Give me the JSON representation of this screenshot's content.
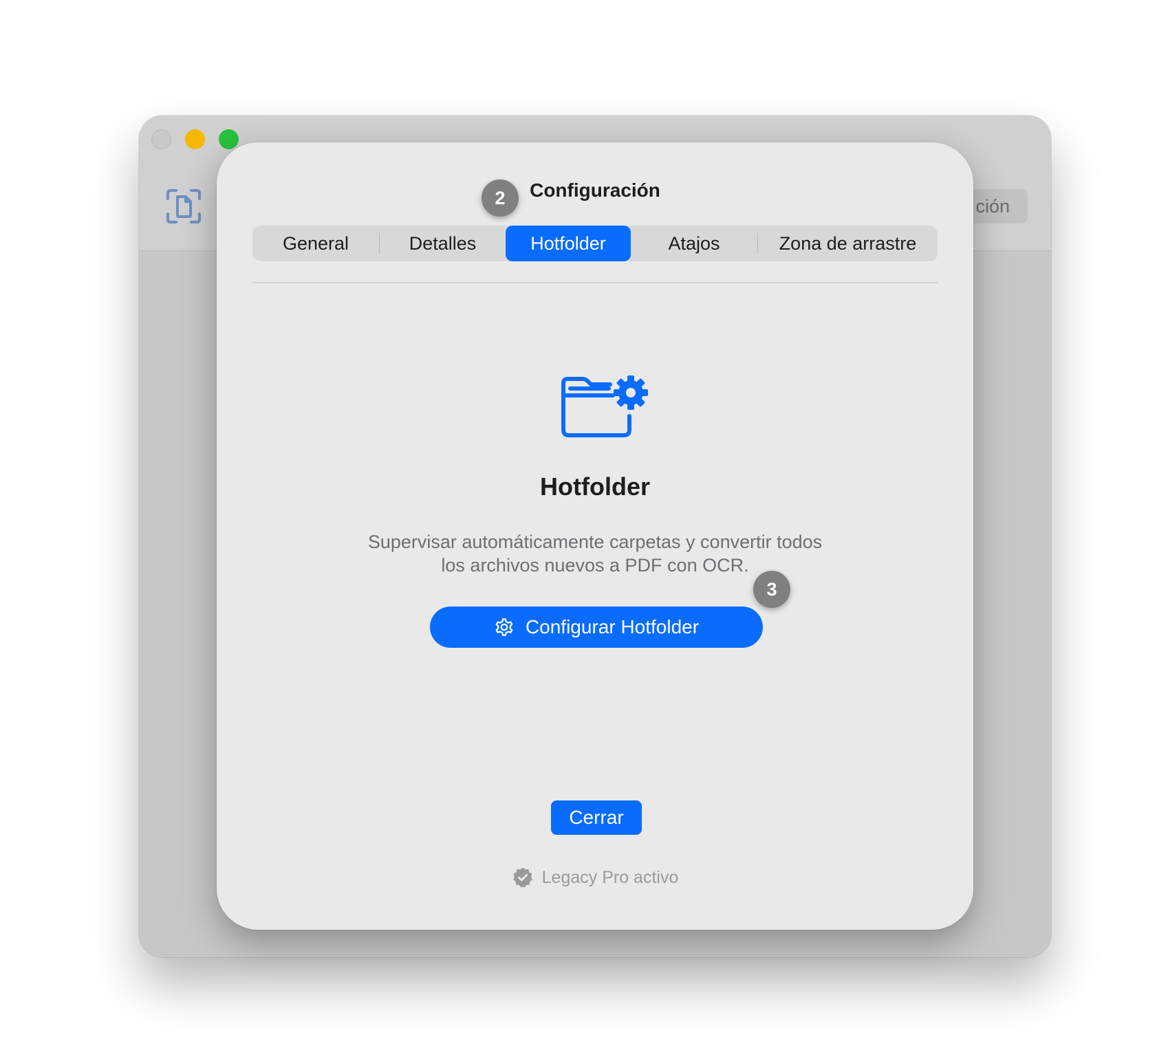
{
  "background_window": {
    "toolbar_button_label": "ción"
  },
  "sheet": {
    "title": "Configuración",
    "tabs": [
      {
        "label": "General",
        "active": false
      },
      {
        "label": "Detalles",
        "active": false
      },
      {
        "label": "Hotfolder",
        "active": true
      },
      {
        "label": "Atajos",
        "active": false
      },
      {
        "label": "Zona de arrastre",
        "active": false
      }
    ],
    "hero": {
      "icon": "folder-gear-icon",
      "title": "Hotfolder",
      "description_line1": "Supervisar automáticamente carpetas y convertir todos",
      "description_line2": "los archivos nuevos a PDF con OCR."
    },
    "configure_button": {
      "icon": "gear-icon",
      "label": "Configurar Hotfolder"
    },
    "close_button": {
      "label": "Cerrar"
    },
    "license": {
      "icon": "verified-seal-icon",
      "text": "Legacy Pro activo"
    }
  },
  "annotations": {
    "step_2": "2",
    "step_3": "3"
  },
  "colors": {
    "accent": "#0a6cff",
    "sheet_background": "#e9e9e9",
    "badge": "#808080",
    "traffic_min": "#f5b700",
    "traffic_max": "#27c13f"
  }
}
